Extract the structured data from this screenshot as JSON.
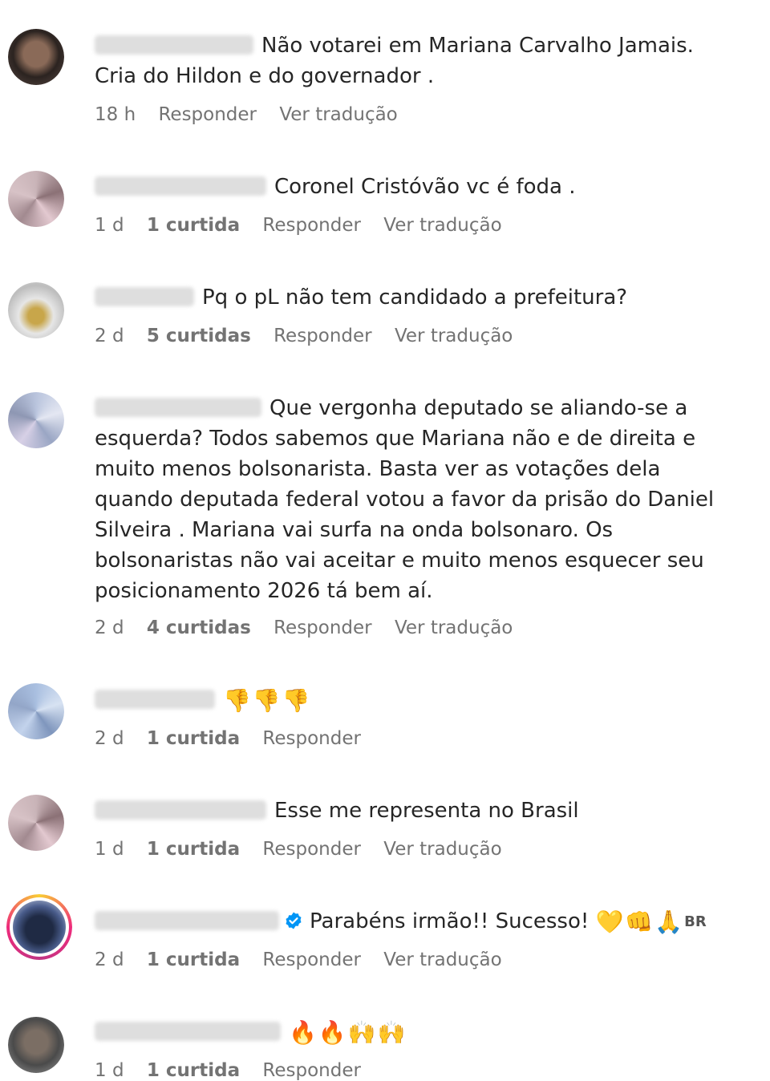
{
  "comments": [
    {
      "text": "Não votarei em Mariana Carvalho Jamais. Cria do Hildon e do governador .",
      "time": "18 h",
      "likes": "",
      "reply": "Responder",
      "translate": "Ver tradução"
    },
    {
      "text": "Coronel Cristóvão vc é foda .",
      "time": "1 d",
      "likes": "1 curtida",
      "reply": "Responder",
      "translate": "Ver tradução"
    },
    {
      "text": "Pq o pL não tem candidado a prefeitura?",
      "time": "2 d",
      "likes": "5 curtidas",
      "reply": "Responder",
      "translate": "Ver tradução"
    },
    {
      "text": "Que vergonha deputado se aliando-se a esquerda? Todos sabemos que Mariana não e de direita e muito menos bolsonarista. Basta ver as votações dela quando deputada federal votou a favor da prisão do Daniel Silveira . Mariana vai surfa na onda bolsonaro. Os bolsonaristas não vai aceitar e muito menos esquecer seu posicionamento 2026 tá bem aí.",
      "time": "2 d",
      "likes": "4 curtidas",
      "reply": "Responder",
      "translate": "Ver tradução"
    },
    {
      "text": "👎👎👎",
      "time": "2 d",
      "likes": "1 curtida",
      "reply": "Responder",
      "translate": ""
    },
    {
      "text": "Esse me representa no Brasil",
      "time": "1 d",
      "likes": "1 curtida",
      "reply": "Responder",
      "translate": "Ver tradução"
    },
    {
      "text": "Parabéns irmão!! Sucesso! ",
      "emoji": "💛👊🙏",
      "flag": "BR",
      "time": "2 d",
      "likes": "1 curtida",
      "reply": "Responder",
      "translate": "Ver tradução"
    },
    {
      "text": "🔥🔥🙌🙌",
      "time": "1 d",
      "likes": "1 curtida",
      "reply": "Responder",
      "translate": ""
    }
  ],
  "colors": {
    "text": "#262626",
    "meta": "#737373",
    "verified": "#0095f6"
  }
}
